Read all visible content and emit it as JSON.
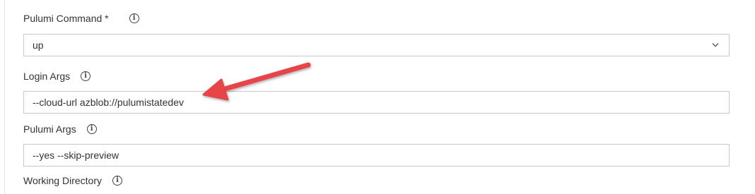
{
  "form": {
    "pulumi_command": {
      "label": "Pulumi Command *",
      "value": "up",
      "info_icon": "info-icon",
      "dropdown_icon": "chevron-down-icon"
    },
    "login_args": {
      "label": "Login Args",
      "value": "--cloud-url azblob://pulumistatedev",
      "info_icon": "info-icon"
    },
    "pulumi_args": {
      "label": "Pulumi Args",
      "value": "--yes --skip-preview",
      "info_icon": "info-icon"
    },
    "working_directory": {
      "label": "Working Directory",
      "info_icon": "info-icon"
    }
  },
  "annotation": {
    "arrow_color": "#e8444a"
  },
  "colors": {
    "border": "#c8c8c8",
    "text": "#333333"
  }
}
